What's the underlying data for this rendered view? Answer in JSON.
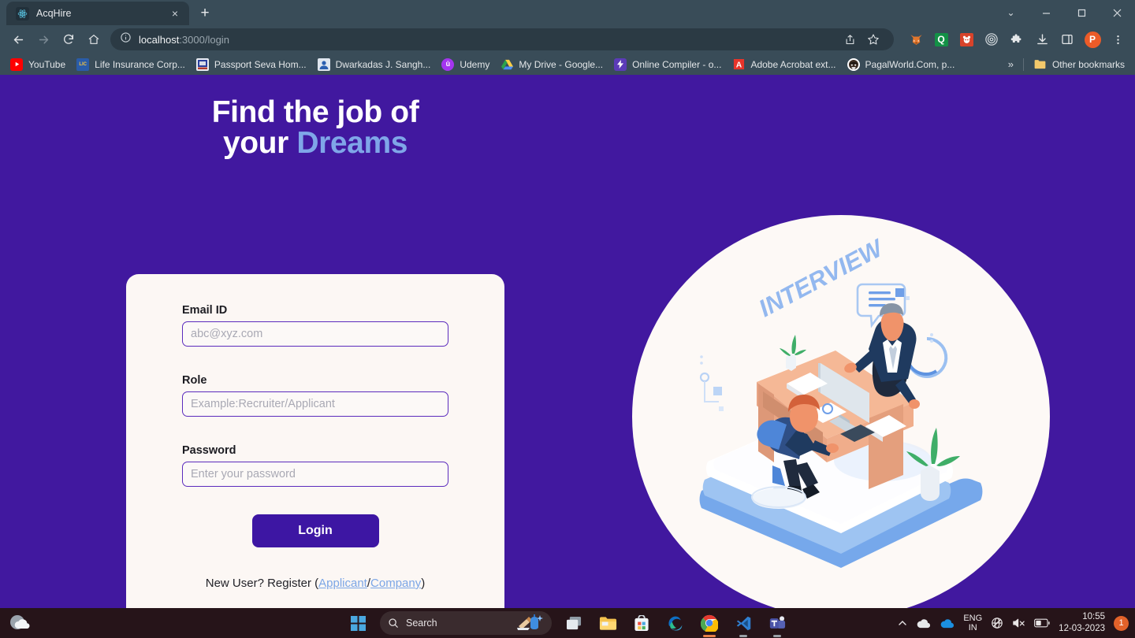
{
  "browser": {
    "tab": {
      "title": "AcqHire",
      "favicon": "react-atom-icon",
      "close_label": "×"
    },
    "new_tab_label": "+",
    "window_controls": [
      {
        "name": "tab-search",
        "glyph": "⌄"
      },
      {
        "name": "minimize",
        "glyph": "—"
      },
      {
        "name": "maximize",
        "glyph": "❐"
      },
      {
        "name": "close",
        "glyph": "✕"
      }
    ],
    "nav": {
      "back": "←",
      "forward": "→",
      "reload": "⟳",
      "home": "⌂"
    },
    "omnibox": {
      "info_icon": "site-info-icon",
      "url_host": "localhost",
      "url_path": ":3000/login",
      "share_icon": "share-icon",
      "bookmark_icon": "star-icon"
    },
    "toolbar_icons": [
      {
        "name": "extension-fox-icon",
        "glyph": "🦊",
        "color": "#e07b3c"
      },
      {
        "name": "extension-quizlet-icon",
        "glyph": "Q",
        "color": "#1a8a3c"
      },
      {
        "name": "extension-panda-icon",
        "glyph": "🐾",
        "color": "#d8482a"
      },
      {
        "name": "extension-target-icon",
        "glyph": "◎",
        "color": "#c9cfd3"
      },
      {
        "name": "extensions-puzzle-icon",
        "glyph": "🧩",
        "color": "#e4e7e9"
      },
      {
        "name": "downloads-icon",
        "glyph": "⤓",
        "color": "#e4e7e9"
      },
      {
        "name": "side-panel-icon",
        "glyph": "▧",
        "color": "#e4e7e9"
      },
      {
        "name": "profile-avatar",
        "glyph": "P",
        "color": "#ec5b28"
      },
      {
        "name": "chrome-menu-icon",
        "glyph": "⋮",
        "color": "#e4e7e9"
      }
    ],
    "bookmarks": [
      {
        "label": "YouTube",
        "icon": "youtube-icon",
        "color": "#ff0000",
        "glyph": "▶"
      },
      {
        "label": "Life Insurance Corp...",
        "icon": "lic-icon",
        "color": "#1f4fa8",
        "glyph": "LIC"
      },
      {
        "label": "Passport Seva Hom...",
        "icon": "passport-seva-icon",
        "color": "#23409a",
        "glyph": "▤"
      },
      {
        "label": "Dwarkadas J. Sangh...",
        "icon": "djsce-icon",
        "color": "#2a5fb0",
        "glyph": "👤"
      },
      {
        "label": "Udemy",
        "icon": "udemy-icon",
        "color": "#a435f0",
        "glyph": "û"
      },
      {
        "label": "My Drive - Google...",
        "icon": "google-drive-icon",
        "color": "#1aa260",
        "glyph": "△"
      },
      {
        "label": "Online Compiler - o...",
        "icon": "online-compiler-icon",
        "color": "#5b3bb8",
        "glyph": "⚡"
      },
      {
        "label": "Adobe Acrobat ext...",
        "icon": "adobe-acrobat-icon",
        "color": "#e8342a",
        "glyph": "A"
      },
      {
        "label": "PagalWorld.Com, p...",
        "icon": "pagalworld-icon",
        "color": "#2b2b2b",
        "glyph": "😀"
      }
    ],
    "bookmarks_overflow": "»",
    "other_bookmarks": {
      "label": "Other bookmarks",
      "icon": "folder-icon"
    }
  },
  "page": {
    "hero": {
      "line1": "Find the job of",
      "line2_prefix": "your ",
      "line2_accent": "Dreams",
      "accent_color": "#7fa6e8"
    },
    "form": {
      "email": {
        "label": "Email ID",
        "value": "",
        "placeholder": "abc@xyz.com"
      },
      "role": {
        "label": "Role",
        "value": "",
        "placeholder": "Example:Recruiter/Applicant"
      },
      "password": {
        "label": "Password",
        "value": "",
        "placeholder": "Enter your password"
      },
      "login_button": "Login"
    },
    "register": {
      "prompt": "New User? Register",
      "open_paren": "(",
      "applicant_link": "Applicant",
      "separator": "/",
      "company_link": "Company",
      "close_paren": ")"
    },
    "illustration": {
      "label": "INTERVIEW",
      "name": "job-interview-illustration",
      "circle_color": "#fdf9f6"
    },
    "background_color": "#41189f",
    "card_color": "#fcf7f4",
    "primary_color": "#3d16a3"
  },
  "taskbar": {
    "weather_icon": "weather-moon-cloud-icon",
    "start_label": "Start",
    "search_placeholder": "Search",
    "icons": [
      {
        "name": "start-button",
        "label": "Start"
      },
      {
        "name": "search-box",
        "label": "Search"
      },
      {
        "name": "task-view-button",
        "label": "Task View"
      },
      {
        "name": "file-explorer-button",
        "label": "File Explorer"
      },
      {
        "name": "microsoft-store-button",
        "label": "Microsoft Store"
      },
      {
        "name": "microsoft-edge-button",
        "label": "Microsoft Edge"
      },
      {
        "name": "google-chrome-button",
        "label": "Google Chrome"
      },
      {
        "name": "vs-code-button",
        "label": "Visual Studio Code"
      },
      {
        "name": "microsoft-teams-button",
        "label": "Microsoft Teams"
      }
    ],
    "tray": {
      "overflow_chevron": "⌃",
      "language_line1": "ENG",
      "language_line2": "IN",
      "network_icon": "network-offline-icon",
      "volume_icon": "volume-muted-icon",
      "battery_icon": "battery-icon",
      "time": "10:55",
      "date": "12-03-2023",
      "notification_count": "1"
    }
  }
}
